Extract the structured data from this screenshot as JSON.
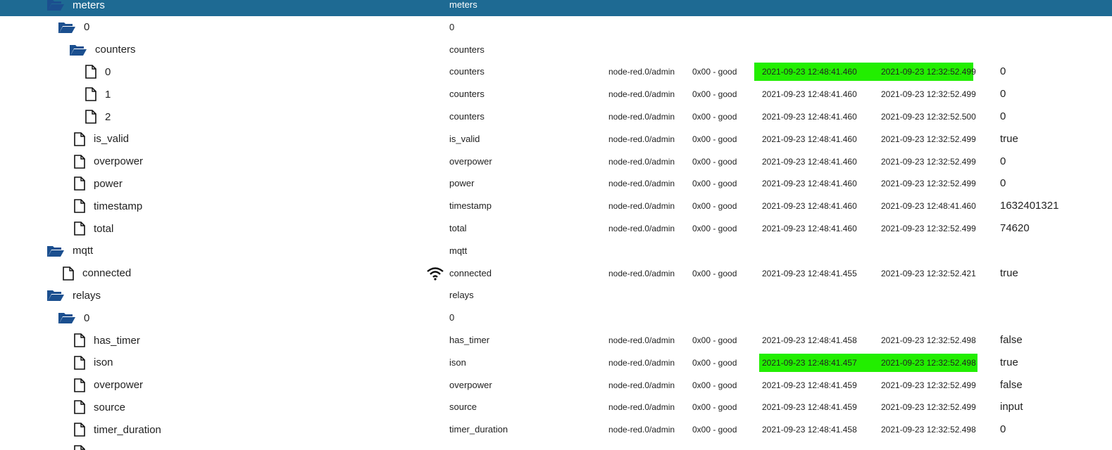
{
  "colors": {
    "selected_row_bg": "#1e6a93",
    "folder_icon": "#1b4f8f",
    "flash_highlight": "#22ee00"
  },
  "rows": [
    {
      "level": 2,
      "type": "folder",
      "name": "meters",
      "role": "meters",
      "selected": true
    },
    {
      "level": 3,
      "type": "folder",
      "name": "0",
      "role": "0"
    },
    {
      "level": 4,
      "type": "folder",
      "name": "counters",
      "role": "counters"
    },
    {
      "level": 5,
      "type": "state",
      "name": "0",
      "role": "counters",
      "from": "node-red.0/admin",
      "quality": "0x00 - good",
      "ts": "2021-09-23 12:48:41.460",
      "lc": "2021-09-23 12:32:52.499",
      "value": "0",
      "flash": true
    },
    {
      "level": 5,
      "type": "state",
      "name": "1",
      "role": "counters",
      "from": "node-red.0/admin",
      "quality": "0x00 - good",
      "ts": "2021-09-23 12:48:41.460",
      "lc": "2021-09-23 12:32:52.499",
      "value": "0"
    },
    {
      "level": 5,
      "type": "state",
      "name": "2",
      "role": "counters",
      "from": "node-red.0/admin",
      "quality": "0x00 - good",
      "ts": "2021-09-23 12:48:41.460",
      "lc": "2021-09-23 12:32:52.500",
      "value": "0"
    },
    {
      "level": 4,
      "type": "state",
      "name": "is_valid",
      "role": "is_valid",
      "from": "node-red.0/admin",
      "quality": "0x00 - good",
      "ts": "2021-09-23 12:48:41.460",
      "lc": "2021-09-23 12:32:52.499",
      "value": "true"
    },
    {
      "level": 4,
      "type": "state",
      "name": "overpower",
      "role": "overpower",
      "from": "node-red.0/admin",
      "quality": "0x00 - good",
      "ts": "2021-09-23 12:48:41.460",
      "lc": "2021-09-23 12:32:52.499",
      "value": "0"
    },
    {
      "level": 4,
      "type": "state",
      "name": "power",
      "role": "power",
      "from": "node-red.0/admin",
      "quality": "0x00 - good",
      "ts": "2021-09-23 12:48:41.460",
      "lc": "2021-09-23 12:32:52.499",
      "value": "0"
    },
    {
      "level": 4,
      "type": "state",
      "name": "timestamp",
      "role": "timestamp",
      "from": "node-red.0/admin",
      "quality": "0x00 - good",
      "ts": "2021-09-23 12:48:41.460",
      "lc": "2021-09-23 12:48:41.460",
      "value": "1632401321"
    },
    {
      "level": 4,
      "type": "state",
      "name": "total",
      "role": "total",
      "from": "node-red.0/admin",
      "quality": "0x00 - good",
      "ts": "2021-09-23 12:48:41.460",
      "lc": "2021-09-23 12:32:52.499",
      "value": "74620"
    },
    {
      "level": 2,
      "type": "folder",
      "name": "mqtt",
      "role": "mqtt"
    },
    {
      "level": 3,
      "type": "state",
      "name": "connected",
      "role": "connected",
      "icon": "wifi-icon",
      "from": "node-red.0/admin",
      "quality": "0x00 - good",
      "ts": "2021-09-23 12:48:41.455",
      "lc": "2021-09-23 12:32:52.421",
      "value": "true"
    },
    {
      "level": 2,
      "type": "folder",
      "name": "relays",
      "role": "relays"
    },
    {
      "level": 3,
      "type": "folder",
      "name": "0",
      "role": "0"
    },
    {
      "level": 4,
      "type": "state",
      "name": "has_timer",
      "role": "has_timer",
      "from": "node-red.0/admin",
      "quality": "0x00 - good",
      "ts": "2021-09-23 12:48:41.458",
      "lc": "2021-09-23 12:32:52.498",
      "value": "false"
    },
    {
      "level": 4,
      "type": "state",
      "name": "ison",
      "role": "ison",
      "from": "node-red.0/admin",
      "quality": "0x00 - good",
      "ts": "2021-09-23 12:48:41.457",
      "lc": "2021-09-23 12:32:52.498",
      "value": "true",
      "flash": true
    },
    {
      "level": 4,
      "type": "state",
      "name": "overpower",
      "role": "overpower",
      "from": "node-red.0/admin",
      "quality": "0x00 - good",
      "ts": "2021-09-23 12:48:41.459",
      "lc": "2021-09-23 12:32:52.499",
      "value": "false"
    },
    {
      "level": 4,
      "type": "state",
      "name": "source",
      "role": "source",
      "from": "node-red.0/admin",
      "quality": "0x00 - good",
      "ts": "2021-09-23 12:48:41.459",
      "lc": "2021-09-23 12:32:52.499",
      "value": "input"
    },
    {
      "level": 4,
      "type": "state",
      "name": "timer_duration",
      "role": "timer_duration",
      "from": "node-red.0/admin",
      "quality": "0x00 - good",
      "ts": "2021-09-23 12:48:41.458",
      "lc": "2021-09-23 12:32:52.498",
      "value": "0"
    },
    {
      "level": 4,
      "type": "state",
      "name": "",
      "role": ""
    }
  ]
}
